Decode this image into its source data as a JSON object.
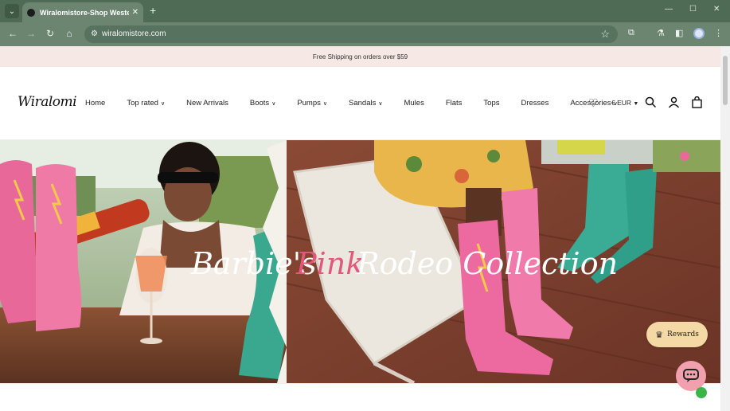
{
  "browser": {
    "tab_title": "Wiralomistore-Shop Western S",
    "url": "wiralomistore.com"
  },
  "announcement": "Free Shipping on orders over $59",
  "header": {
    "logo": "Wiralomi",
    "nav": [
      {
        "label": "Home",
        "dropdown": false
      },
      {
        "label": "Top rated",
        "dropdown": true
      },
      {
        "label": "New Arrivals",
        "dropdown": false
      },
      {
        "label": "Boots",
        "dropdown": true
      },
      {
        "label": "Pumps",
        "dropdown": true
      },
      {
        "label": "Sandals",
        "dropdown": true
      },
      {
        "label": "Mules",
        "dropdown": false
      },
      {
        "label": "Flats",
        "dropdown": false
      },
      {
        "label": "Tops",
        "dropdown": false
      },
      {
        "label": "Dresses",
        "dropdown": false
      },
      {
        "label": "Accessories",
        "dropdown": true
      }
    ],
    "currency": "€ EUR"
  },
  "hero": {
    "title_part1": "Barbie's",
    "title_part2": "Pink",
    "title_part3": "Rodeo Collection"
  },
  "widgets": {
    "rewards_label": "Rewards"
  },
  "colors": {
    "accent_pink": "#e2587c",
    "chrome_green": "#4f6b55",
    "rewards_bg": "#f4d8a6"
  }
}
